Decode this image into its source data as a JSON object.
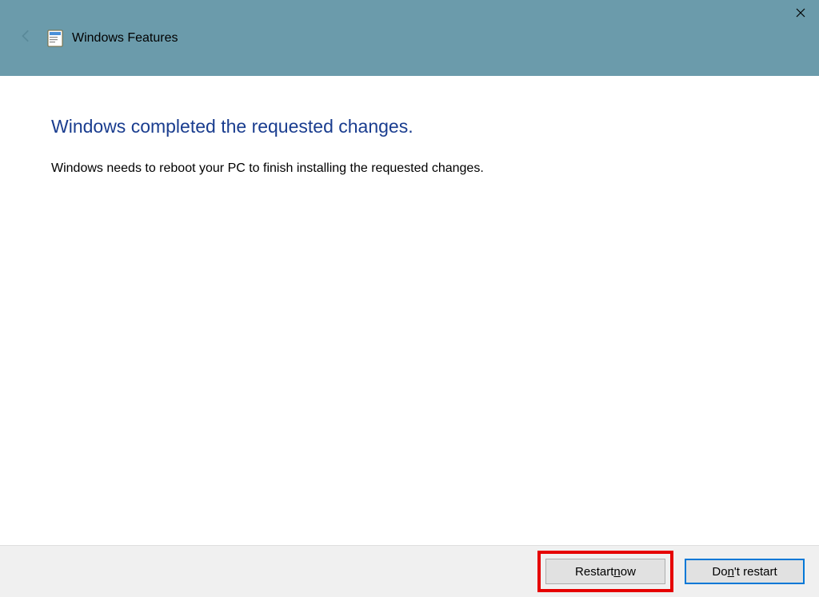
{
  "titlebar": {
    "title": "Windows Features"
  },
  "content": {
    "heading": "Windows completed the requested changes.",
    "body": "Windows needs to reboot your PC to finish installing the requested changes."
  },
  "footer": {
    "restart_prefix": "Restart ",
    "restart_u": "n",
    "restart_suffix": "ow",
    "dont_prefix": "Do",
    "dont_u": "n",
    "dont_suffix": "'t restart"
  }
}
